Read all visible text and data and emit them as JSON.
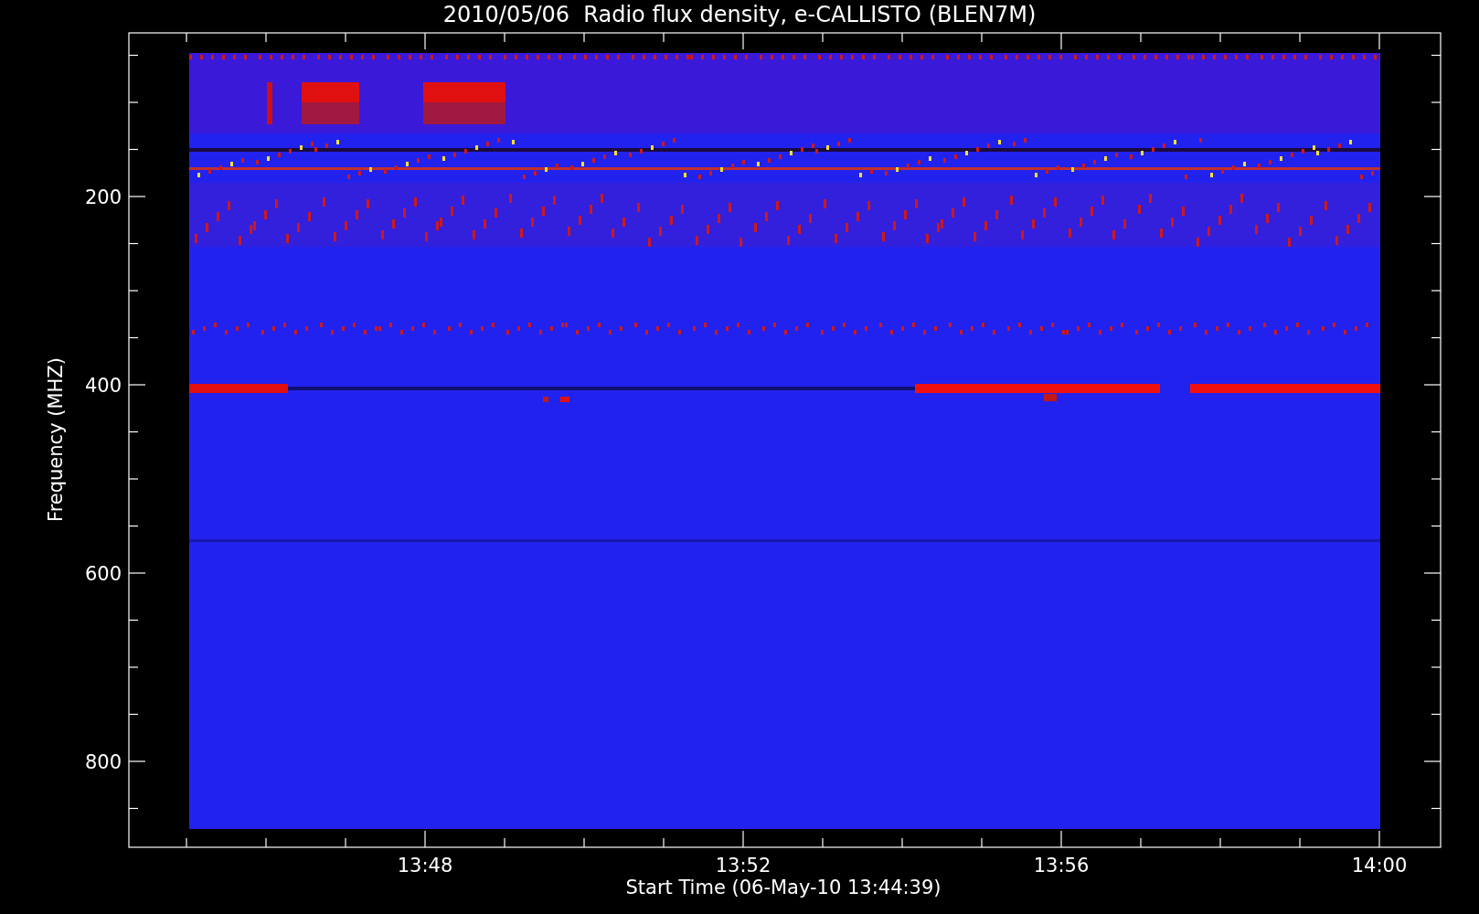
{
  "title": "2010/05/06  Radio flux density, e-CALLISTO (BLEN7M)",
  "y_axis": {
    "label": "Frequency (MHZ)",
    "ticks": [
      "200",
      "400",
      "600",
      "800"
    ]
  },
  "x_axis": {
    "label": "Start Time (06-May-10 13:44:39)",
    "ticks": [
      "13:48",
      "13:52",
      "13:56",
      "14:00"
    ]
  }
}
